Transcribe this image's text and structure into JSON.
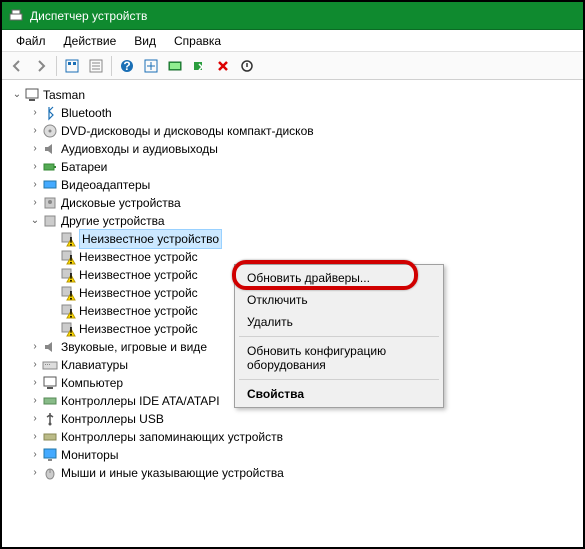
{
  "title": "Диспетчер устройств",
  "menu": {
    "file": "Файл",
    "action": "Действие",
    "view": "Вид",
    "help": "Справка"
  },
  "root": "Tasman",
  "categories": {
    "bluetooth": "Bluetooth",
    "dvd": "DVD-дисководы и дисководы компакт-дисков",
    "audio": "Аудиовходы и аудиовыходы",
    "battery": "Батареи",
    "video": "Видеоадаптеры",
    "disk": "Дисковые устройства",
    "other": "Другие устройства",
    "sound": "Звуковые, игровые и виде",
    "keyboard": "Клавиатуры",
    "computer": "Компьютер",
    "ide": "Контроллеры IDE ATA/ATAPI",
    "usb": "Контроллеры USB",
    "storage": "Контроллеры запоминающих устройств",
    "monitor": "Мониторы",
    "mouse": "Мыши и иные указывающие устройства"
  },
  "unknown_full": "Неизвестное устройство",
  "unknown_trunc": "Неизвестное устройс",
  "context": {
    "update": "Обновить драйверы...",
    "disable": "Отключить",
    "delete": "Удалить",
    "scan": "Обновить конфигурацию оборудования",
    "props": "Свойства"
  }
}
